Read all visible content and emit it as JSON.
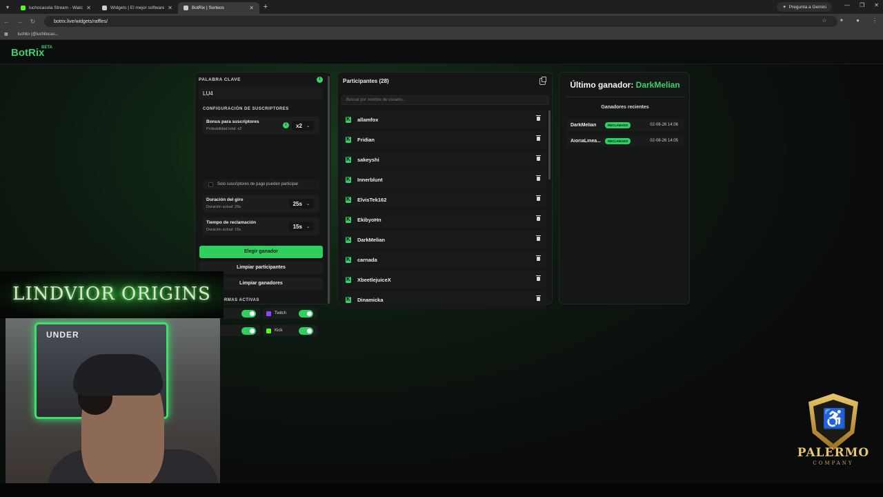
{
  "browser": {
    "tabs": [
      {
        "title": "luchocasola Stream - Watch Live",
        "fav_color": "#53fc18",
        "active": false
      },
      {
        "title": "Widgets | El mejor software para",
        "fav_color": "#cccccc",
        "active": false
      },
      {
        "title": "BotRix | Sorteos",
        "fav_color": "#cccccc",
        "active": true
      }
    ],
    "gemini_label": "Pregunta a Gemini",
    "url": "botrix.live/widgets/raffles/",
    "bookmark": "luchito (@luchitocas..."
  },
  "app": {
    "logo": "BotRix",
    "badge": "BETA"
  },
  "left_panel": {
    "keyword_label": "PALABRA CLAVE",
    "keyword_value": "LU4",
    "sub_config_label": "CONFIGURACIÓN DE SUSCRIPTORES",
    "bonus_title": "Bonus para suscriptores",
    "bonus_sub": "Probabilidad total: x2",
    "bonus_value": "x2",
    "paid_only_label": "Solo suscriptores de pago pueden participar",
    "spin_title": "Duración del giro",
    "spin_sub": "Duración actual: 25s",
    "spin_value": "25s",
    "claim_title": "Tiempo de reclamación",
    "claim_sub": "Duración actual: 15s",
    "claim_value": "15s",
    "pick_winner": "Elegir ganador",
    "clear_participants": "Limpiar participantes",
    "clear_winners": "Limpiar ganadores",
    "platforms_label": "PLATAFORMAS ACTIVAS",
    "platforms": [
      {
        "name": "Twitch",
        "color": "#9146ff",
        "enabled": true
      },
      {
        "name": "Kick",
        "color": "#53fc18",
        "enabled": true
      }
    ]
  },
  "participants": {
    "title": "Participantes (28)",
    "search_placeholder": "Buscar por nombre de usuario...",
    "items": [
      "allamfox",
      "Fridian",
      "sakeyshi",
      "Innerblunt",
      "ElvisTek162",
      "EkibyoHn",
      "DarkMelian",
      "carnada",
      "XbeetlejuiceX",
      "Dinamicka"
    ]
  },
  "winners": {
    "last_label": "Último ganador:",
    "last_name": "DarkMelian",
    "recent_title": "Ganadores recientes",
    "recent": [
      {
        "name": "DarkMelian",
        "status": "RECLAMADO",
        "date": "02-08-26 14:06"
      },
      {
        "name": "AioriaLinea...",
        "status": "RECLAMADO",
        "date": "02-08-26 14:05"
      }
    ]
  },
  "overlays": {
    "banner_text": "LINDVIOR ORIGINS",
    "poster_text": "UNDER",
    "sponsor_name": "PALERMO",
    "sponsor_sub": "COMPANY"
  },
  "colors": {
    "accent": "#2fcf5f",
    "panel": "#151716"
  }
}
